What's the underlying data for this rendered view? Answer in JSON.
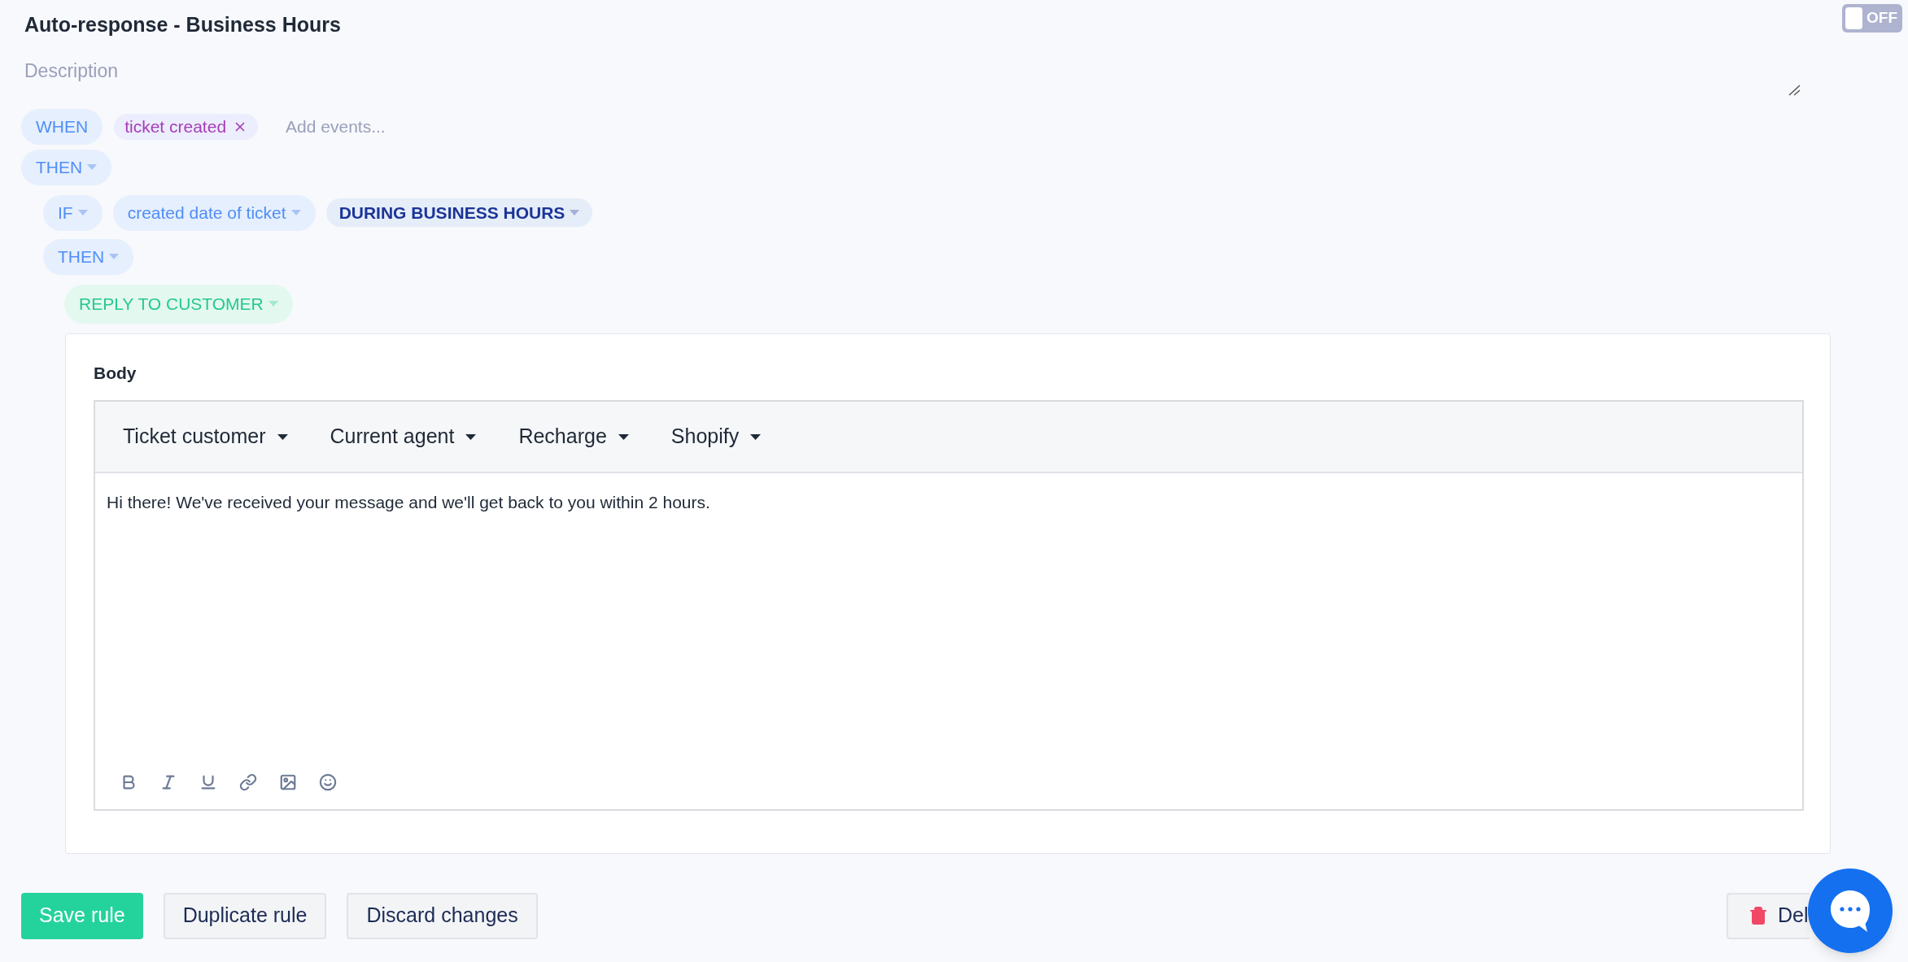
{
  "rule": {
    "title": "Auto-response - Business Hours",
    "active": false,
    "toggle_label": "OFF"
  },
  "description": {
    "placeholder": "Description"
  },
  "when": {
    "label": "WHEN",
    "events": [
      {
        "label": "ticket created"
      }
    ],
    "add_placeholder": "Add events..."
  },
  "then": {
    "label": "THEN"
  },
  "condition": {
    "if": "IF",
    "field": "created date of ticket",
    "operator": "DURING BUSINESS HOURS",
    "then": "THEN"
  },
  "action": {
    "label": "REPLY TO CUSTOMER",
    "body_label": "Body",
    "variable_menus": [
      "Ticket customer",
      "Current agent",
      "Recharge",
      "Shopify"
    ],
    "body_text": "Hi there! We've received your message and we'll get back to you within 2 hours.",
    "format_tools": [
      {
        "kind": "bold"
      },
      {
        "kind": "italic"
      },
      {
        "kind": "underline"
      },
      {
        "kind": "link"
      },
      {
        "kind": "image"
      },
      {
        "kind": "emoji"
      }
    ]
  },
  "buttons": [
    {
      "label": "Save rule",
      "kind": "primary"
    },
    {
      "label": "Duplicate rule",
      "kind": "secondary"
    },
    {
      "label": "Discard changes",
      "kind": "secondary"
    }
  ],
  "delete_button": {
    "label": "Del"
  }
}
